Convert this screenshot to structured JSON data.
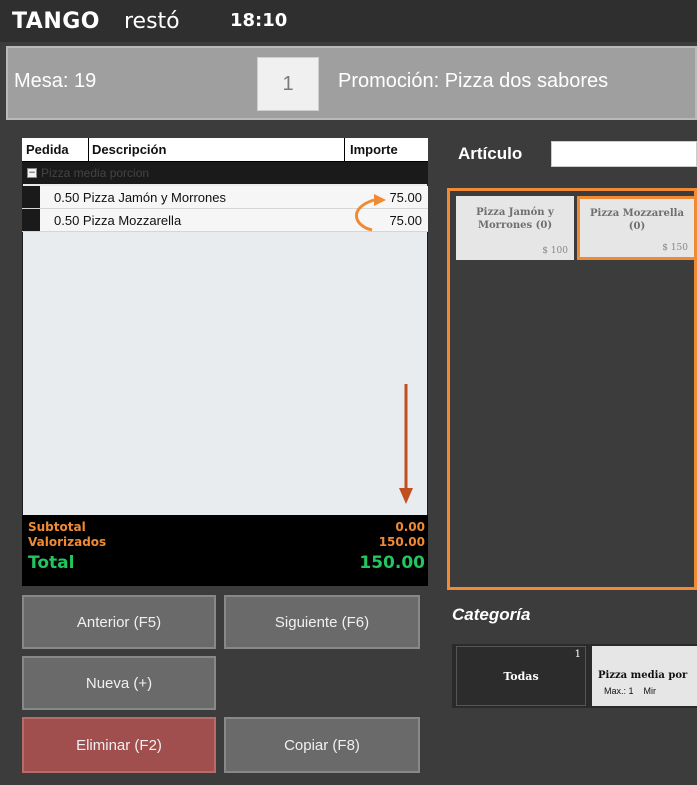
{
  "header": {
    "brand_main": "TANGO",
    "brand_sub": "restó",
    "clock": "18:10"
  },
  "order_header": {
    "table_label": "Mesa: 19",
    "quantity": "1",
    "promotion": "Promoción: Pizza dos sabores"
  },
  "order_table": {
    "columns": [
      "Pedida",
      "Descripción",
      "Importe"
    ],
    "group_label": "Pizza media porcion",
    "items": [
      {
        "description": "0.50 Pizza Jamón y Morrones",
        "amount": "75.00"
      },
      {
        "description": "0.50 Pizza Mozzarella",
        "amount": "75.00"
      }
    ],
    "totals": {
      "subtotal_label": "Subtotal",
      "subtotal_value": "0.00",
      "valorizados_label": "Valorizados",
      "valorizados_value": "150.00",
      "total_label": "Total",
      "total_value": "150.00"
    }
  },
  "buttons": {
    "previous": "Anterior (F5)",
    "next": "Siguiente (F6)",
    "new": "Nueva (+)",
    "delete": "Eliminar (F2)",
    "copy": "Copiar (F8)"
  },
  "article_search": {
    "label": "Artículo",
    "value": ""
  },
  "products": [
    {
      "name": "Pizza Jamón y Morrones (0)",
      "price": "$ 100"
    },
    {
      "name": "Pizza Mozzarella (0)",
      "price": "$ 150"
    }
  ],
  "categories": {
    "label": "Categoría",
    "items": [
      {
        "name": "Todas",
        "count": "1"
      },
      {
        "name": "Pizza media por",
        "info": "Max.: 1    Mir"
      }
    ]
  },
  "colors": {
    "accent_orange": "#f08a33",
    "total_green": "#22c55e",
    "subtotal_orange": "#f08a33",
    "delete_red": "#a14e4e"
  }
}
